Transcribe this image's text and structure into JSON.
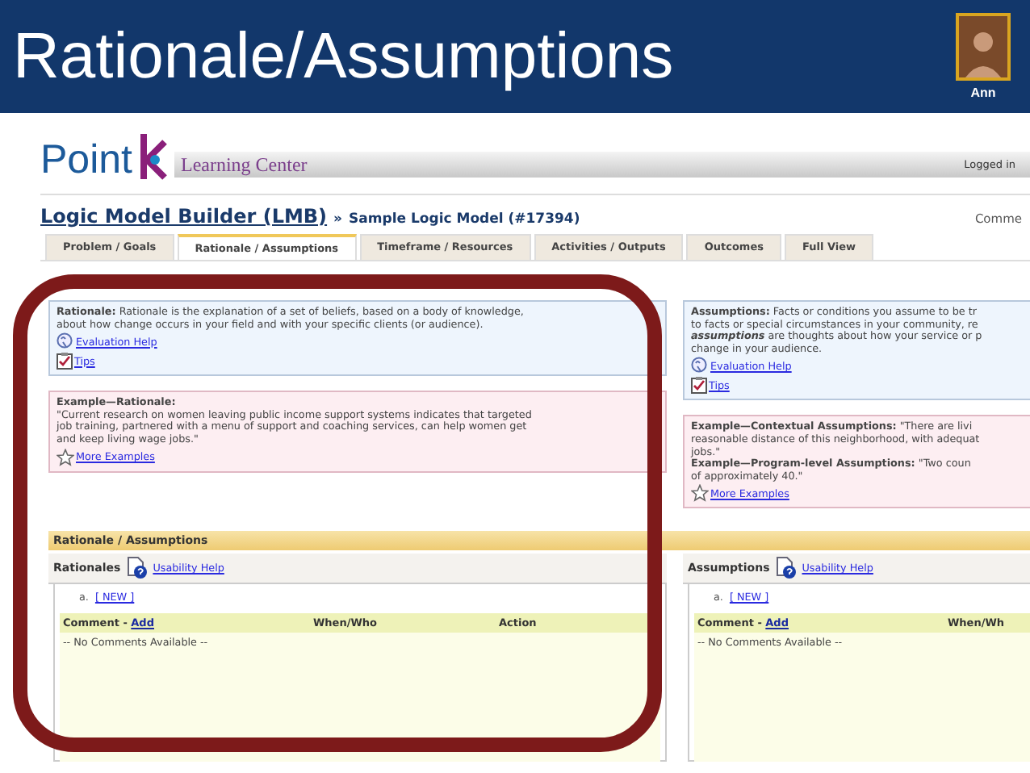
{
  "slide": {
    "title": "Rationale/Assumptions",
    "presenter": "Ann"
  },
  "app": {
    "logo": "Point",
    "product": "Learning Center",
    "user_status": "Logged in",
    "builder_title": "Logic Model Builder (LMB)",
    "separator": "»",
    "model_title": "Sample Logic Model (#17394)",
    "right_link": "Comme"
  },
  "tabs": [
    {
      "label": "Problem / Goals",
      "selected": false
    },
    {
      "label": "Rationale / Assumptions",
      "selected": true
    },
    {
      "label": "Timeframe / Resources",
      "selected": false
    },
    {
      "label": "Activities / Outputs",
      "selected": false
    },
    {
      "label": "Outcomes",
      "selected": false
    },
    {
      "label": "Full View",
      "selected": false
    }
  ],
  "columns": [
    {
      "info": {
        "lines": [
          "**Rationale:** Rationale is the explanation of a set of beliefs, based on a body of knowledge,",
          "about how change occurs in your field and with your specific clients (or audience)."
        ],
        "links": [
          {
            "kind": "help",
            "label": "Evaluation Help"
          },
          {
            "kind": "tips",
            "label": "Tips"
          }
        ]
      },
      "example": {
        "heading": "Example—Rationale:",
        "lines": [
          "\"Current research on women leaving public income support systems indicates that targeted",
          "job training, partnered with a menu of support and coaching services, can help women get",
          "and keep living wage jobs.\""
        ],
        "link": "More Examples"
      }
    },
    {
      "info": {
        "lines": [
          "**Assumptions:** Facts or conditions you assume to be tr",
          "to facts or special circumstances in your community, re",
          "*assumptions* are thoughts about how your service or p",
          "change in your audience."
        ],
        "links": [
          {
            "kind": "help",
            "label": "Evaluation Help"
          },
          {
            "kind": "tips",
            "label": "Tips"
          }
        ]
      },
      "example": {
        "lines": [
          "**Example—Contextual Assumptions:**  \"There are livi",
          "reasonable distance of this neighborhood, with adequat",
          "jobs.\"",
          "**Example—Program-level Assumptions:**  \"Two coun",
          "of approximately 40.\""
        ],
        "link": "More Examples"
      }
    }
  ],
  "section_title": "Rationale / Assumptions",
  "panels": [
    {
      "title": "Rationales",
      "help": "Usability Help",
      "marker": "a.",
      "new_link": "[ NEW ]",
      "headers": [
        {
          "kind": "comment",
          "label": "Comment - ",
          "action": "Add"
        },
        {
          "kind": "plain",
          "label": "When/Who"
        },
        {
          "kind": "plain",
          "label": "Action"
        }
      ],
      "empty_message": "-- No Comments Available --"
    },
    {
      "title": "Assumptions",
      "help": "Usability Help",
      "marker": "a.",
      "new_link": "[ NEW ]",
      "headers": [
        {
          "kind": "comment",
          "label": "Comment - ",
          "action": "Add"
        },
        {
          "kind": "plain",
          "label": "When/Wh"
        }
      ],
      "empty_message": "-- No Comments Available --"
    }
  ]
}
